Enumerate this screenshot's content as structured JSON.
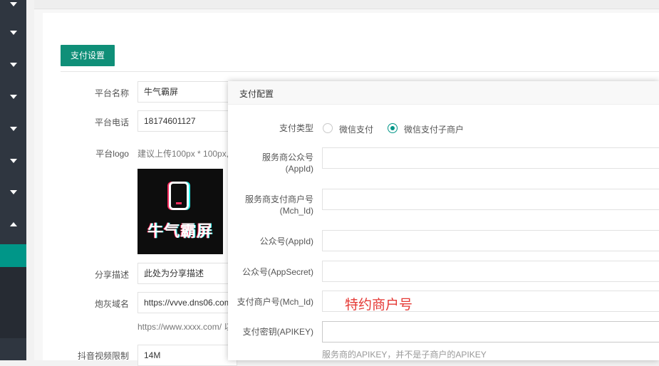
{
  "settings_tab": {
    "label": "支付设置"
  },
  "form": {
    "platform_name": {
      "label": "平台名称",
      "value": "牛气霸屏"
    },
    "platform_phone": {
      "label": "平台电话",
      "value": "18174601127"
    },
    "platform_logo": {
      "label": "平台logo",
      "hint": "建议上传100px * 100px,",
      "logo_text": "牛气霸屏"
    },
    "share_desc": {
      "label": "分享描述",
      "value": "此处为分享描述"
    },
    "cannon_domain": {
      "label": "炮灰域名",
      "value": "https://vvve.dns06.com",
      "hint": "https://www.xxxx.com/ 以"
    },
    "douyin_video_limit": {
      "label": "抖音视频限制",
      "value": "14M"
    }
  },
  "dialog": {
    "title": "支付配置",
    "pay_type": {
      "label": "支付类型",
      "options": [
        {
          "label": "微信支付",
          "selected": false
        },
        {
          "label": "微信支付子商户",
          "selected": true
        }
      ]
    },
    "fields": [
      {
        "label1": "服务商公众号",
        "label2": "(AppId)",
        "value": ""
      },
      {
        "label1": "服务商支付商户号",
        "label2": "(Mch_Id)",
        "value": ""
      },
      {
        "label1": "公众号(AppId)",
        "label2": "",
        "value": ""
      },
      {
        "label1": "公众号(AppSecret)",
        "label2": "",
        "value": ""
      },
      {
        "label1": "支付商户号(Mch_Id)",
        "label2": "",
        "value": ""
      },
      {
        "label1": "支付密钥(APIKEY)",
        "label2": "",
        "value": ""
      }
    ],
    "annotation": "特约商户号",
    "apikey_hint": "服务商的APIKEY，并不是子商户的APIKEY"
  },
  "colors": {
    "accent": "#009688",
    "tab_button": "#0f8f78",
    "sidebar": "#2f3640",
    "annotation": "#e53935"
  }
}
